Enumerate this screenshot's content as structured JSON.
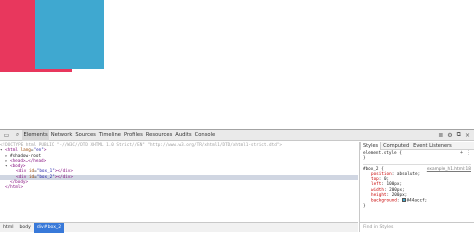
{
  "page": {
    "box_1_color": "#e8375d",
    "box_2_color": "#3fa8d0"
  },
  "toolbar": {
    "tabs": [
      {
        "label": "Elements",
        "active": true
      },
      {
        "label": "Network"
      },
      {
        "label": "Sources"
      },
      {
        "label": "Timeline"
      },
      {
        "label": "Profiles"
      },
      {
        "label": "Resources"
      },
      {
        "label": "Audits"
      },
      {
        "label": "Console"
      }
    ]
  },
  "elements": {
    "doctype": "<!DOCTYPE html PUBLIC \"-//W3C//DTD XHTML 1.0 Strict//EN\" \"http://www.w3.org/TR/xhtml1/DTD/xhtml1-strict.dtd\">",
    "html_open": "<html",
    "html_attr_name": "lang",
    "html_attr_val": "\"en\"",
    "shadow_root": "#shadow-root",
    "head": "<head>…</head>",
    "body_open": "<body>",
    "div1_open": "<div",
    "div1_attr": "id",
    "div1_val": "\"box_1\"",
    "div1_close": "></div>",
    "div2_open": "<div",
    "div2_attr": "id",
    "div2_val": "\"box_2\"",
    "div2_close": "></div>",
    "body_close": "</body>",
    "html_close": "</html>"
  },
  "sidebar": {
    "tabs": [
      "Styles",
      "Computed",
      "Event Listeners"
    ],
    "element_style": "element.style {",
    "element_style_close": "}",
    "selector": "#box_2 {",
    "source_link": "example_h1.html:18",
    "properties": [
      {
        "name": "position",
        "value": "absolute;"
      },
      {
        "name": "top",
        "value": "0;"
      },
      {
        "name": "left",
        "value": "100px;"
      },
      {
        "name": "width",
        "value": "200px;"
      },
      {
        "name": "height",
        "value": "200px;"
      },
      {
        "name": "background",
        "value": "#44accf;"
      }
    ],
    "rule_close": "}",
    "find_placeholder": "Find in Styles"
  },
  "breadcrumbs": [
    "html",
    "body",
    "div#box_2"
  ]
}
